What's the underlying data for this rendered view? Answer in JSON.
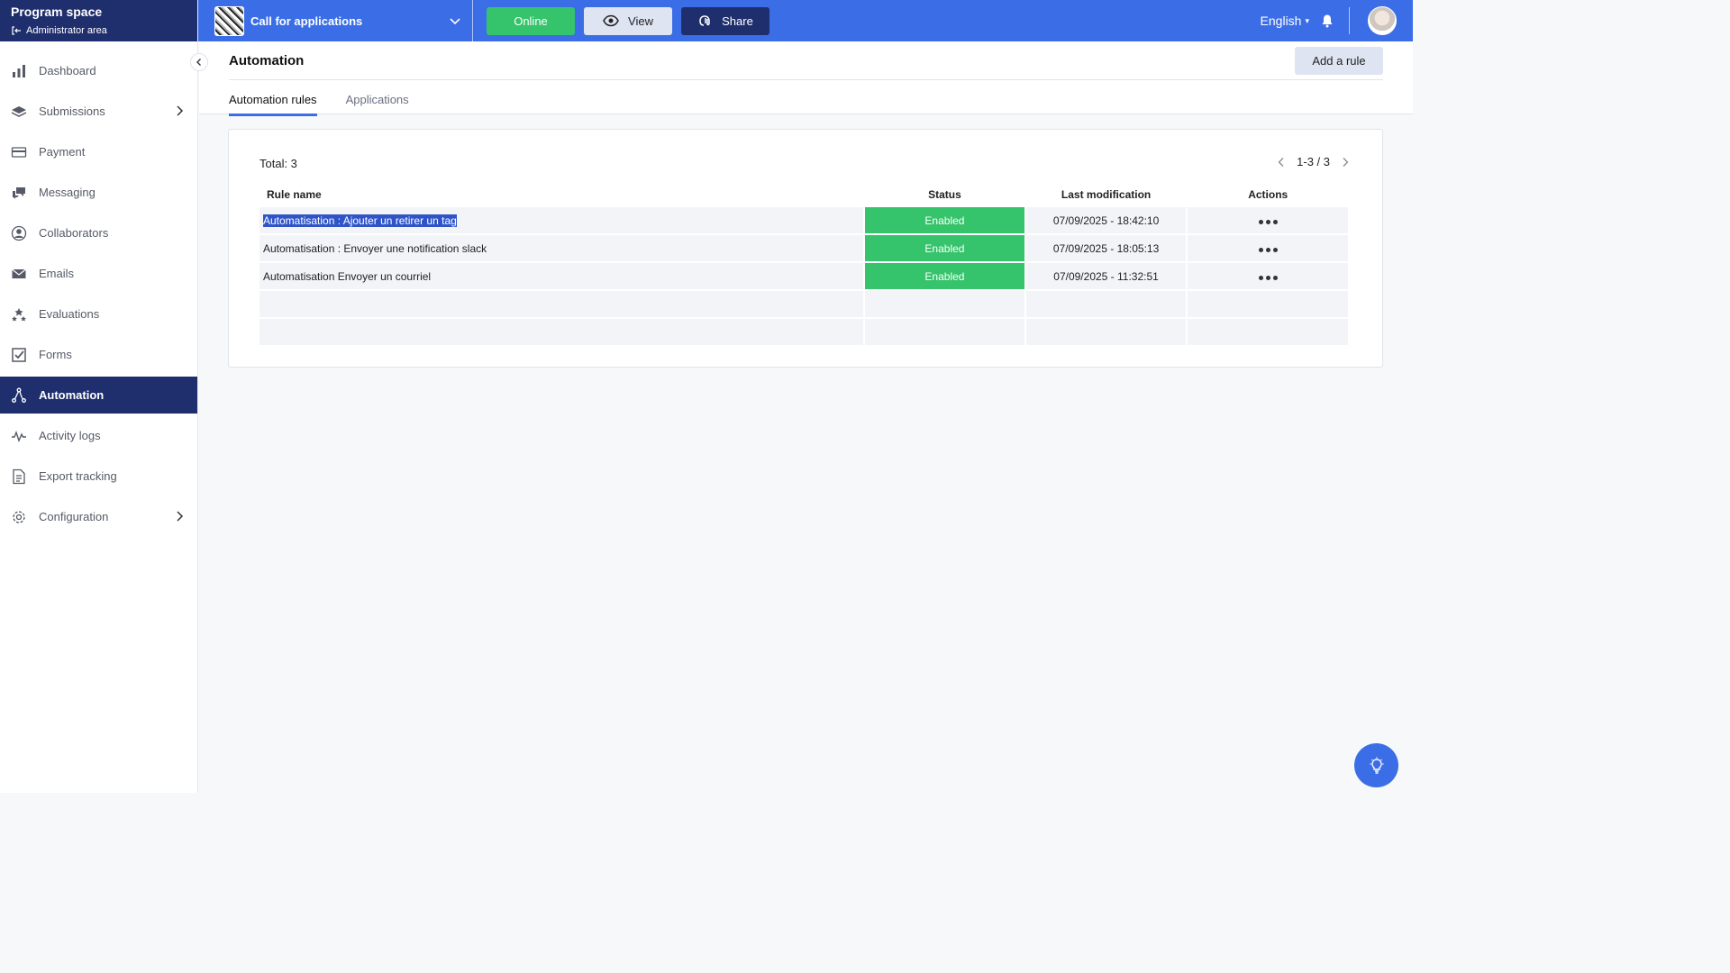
{
  "brand": {
    "title": "Program space",
    "subtitle": "Administrator area"
  },
  "sidebar": {
    "items": [
      {
        "label": "Dashboard",
        "icon": "bar-chart-icon"
      },
      {
        "label": "Submissions",
        "icon": "layers-icon",
        "has_children": true
      },
      {
        "label": "Payment",
        "icon": "credit-card-icon"
      },
      {
        "label": "Messaging",
        "icon": "chat-icon"
      },
      {
        "label": "Collaborators",
        "icon": "user-circle-icon"
      },
      {
        "label": "Emails",
        "icon": "envelope-icon"
      },
      {
        "label": "Evaluations",
        "icon": "stars-icon"
      },
      {
        "label": "Forms",
        "icon": "checkbox-icon"
      },
      {
        "label": "Automation",
        "icon": "automation-icon",
        "active": true
      },
      {
        "label": "Activity logs",
        "icon": "pulse-icon"
      },
      {
        "label": "Export tracking",
        "icon": "document-icon"
      },
      {
        "label": "Configuration",
        "icon": "gear-icon",
        "has_children": true
      }
    ]
  },
  "topbar": {
    "program_name": "Call for applications",
    "online_label": "Online",
    "view_label": "View",
    "share_label": "Share",
    "language": "English"
  },
  "page": {
    "title": "Automation",
    "add_rule_label": "Add a rule",
    "tabs": [
      {
        "label": "Automation rules",
        "active": true
      },
      {
        "label": "Applications",
        "active": false
      }
    ]
  },
  "table": {
    "total_label": "Total: 3",
    "pager_label": "1-3 / 3",
    "headers": {
      "rule_name": "Rule name",
      "status": "Status",
      "last_modification": "Last modification",
      "actions": "Actions"
    },
    "rows": [
      {
        "name": "Automatisation : Ajouter un retirer un tag",
        "status": "Enabled",
        "modified": "07/09/2025 - 18:42:10",
        "selected_text": true
      },
      {
        "name": "Automatisation : Envoyer une notification slack",
        "status": "Enabled",
        "modified": "07/09/2025 - 18:05:13"
      },
      {
        "name": "Automatisation Envoyer un courriel",
        "status": "Enabled",
        "modified": "07/09/2025 - 11:32:51"
      }
    ]
  },
  "colors": {
    "primary": "#3b6ee6",
    "navy": "#1f2f6e",
    "success": "#35c36b"
  }
}
